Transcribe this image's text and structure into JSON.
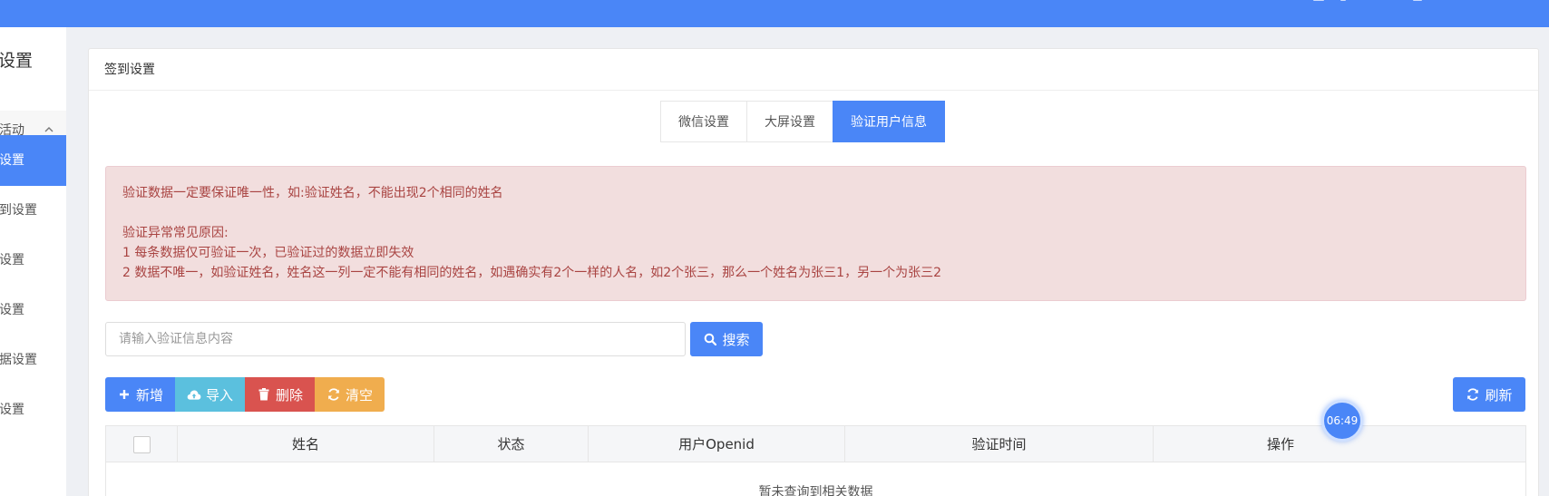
{
  "sidebar": {
    "title": "设置",
    "group": {
      "label": "活动",
      "chevron": "chevron-up-icon"
    },
    "items": [
      {
        "label": "设置",
        "active": true
      },
      {
        "label": "到设置"
      },
      {
        "label": "设置"
      },
      {
        "label": "设置"
      },
      {
        "label": "据设置"
      },
      {
        "label": "设置"
      }
    ]
  },
  "card": {
    "title": "签到设置"
  },
  "tabs": [
    {
      "label": "微信设置"
    },
    {
      "label": "大屏设置"
    },
    {
      "label": "验证用户信息",
      "active": true
    }
  ],
  "alert": {
    "line1": "验证数据一定要保证唯一性，如:验证姓名，不能出现2个相同的姓名",
    "line2": "验证异常常见原因:",
    "line3": "1 每条数据仅可验证一次，已验证过的数据立即失效",
    "line4": "2 数据不唯一，如验证姓名，姓名这一列一定不能有相同的姓名，如遇确实有2个一样的人名，如2个张三，那么一个姓名为张三1，另一个为张三2"
  },
  "search": {
    "placeholder": "请输入验证信息内容",
    "button_label": "搜索"
  },
  "toolbar": {
    "add_label": "新增",
    "import_label": "导入",
    "delete_label": "删除",
    "clear_label": "清空",
    "refresh_label": "刷新"
  },
  "table": {
    "columns": [
      "姓名",
      "状态",
      "用户Openid",
      "验证时间",
      "操作"
    ],
    "empty_text": "暂未查询到相关数据"
  },
  "timer": {
    "text": "06:49"
  },
  "colors": {
    "primary": "#4a86f7",
    "info": "#5bc0de",
    "danger": "#d9534f",
    "warning": "#f0ad4e",
    "alert_bg": "#f2dede",
    "alert_text": "#a94442"
  }
}
